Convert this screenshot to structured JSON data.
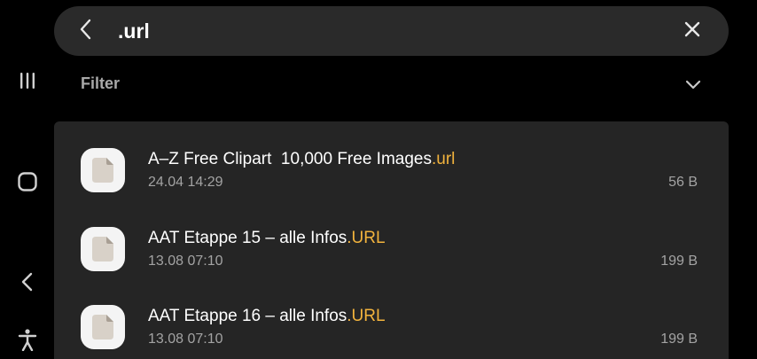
{
  "search": {
    "query": ".url",
    "back_icon": "chevron-left-icon",
    "clear_icon": "close-icon"
  },
  "filter": {
    "label": "Filter",
    "icon": "chevron-down-icon"
  },
  "nav_rail": {
    "icons": [
      "recents-icon",
      "home-icon",
      "back-icon",
      "accessibility-icon"
    ]
  },
  "results": [
    {
      "name": "A–Z Free Clipart  10,000 Free Images",
      "ext": ".url",
      "date": "24.04 14:29",
      "size": "56 B"
    },
    {
      "name": "AAT Etappe 15 – alle Infos",
      "ext": ".URL",
      "date": "13.08 07:10",
      "size": "199 B"
    },
    {
      "name": "AAT Etappe 16 – alle Infos",
      "ext": ".URL",
      "date": "13.08 07:10",
      "size": "199 B"
    }
  ],
  "colors": {
    "background": "#000000",
    "search_bar": "#2a2a2a",
    "panel": "#252525",
    "extension_highlight": "#f2b33d",
    "secondary_text": "#a3a3a3"
  }
}
